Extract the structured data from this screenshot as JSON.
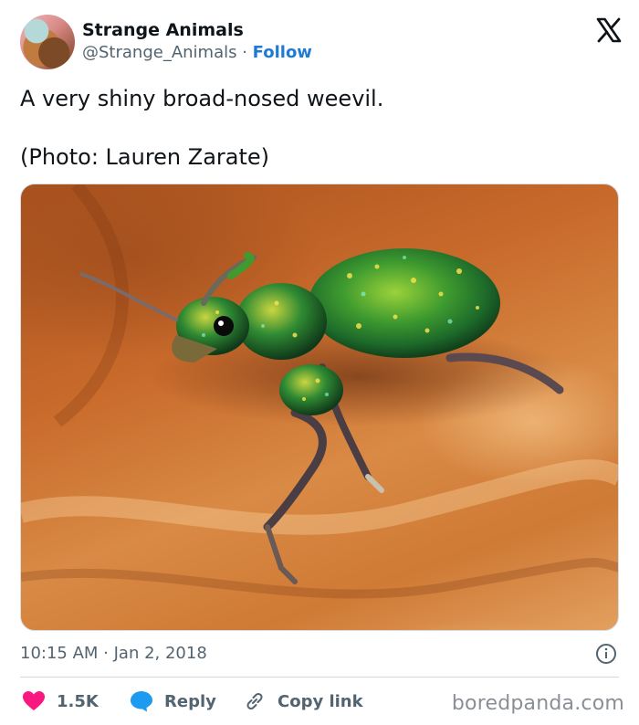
{
  "author": {
    "display_name": "Strange Animals",
    "handle": "@Strange_Animals",
    "separator": " · ",
    "follow_label": "Follow"
  },
  "tweet": {
    "text": "A very shiny broad-nosed weevil.\n\n(Photo: Lauren Zarate)",
    "timestamp": "10:15 AM · Jan 2, 2018"
  },
  "media": {
    "image_label": "green-iridescent-weevil-photo",
    "colors": {
      "wood": "#c86a2b",
      "beetle": "#3f9b2f"
    }
  },
  "actions": {
    "likes_count": "1.5K",
    "reply_label": "Reply",
    "copy_link_label": "Copy link"
  },
  "icons": {
    "platform": "x-logo-icon",
    "info": "info-icon",
    "like": "heart-icon",
    "reply": "speech-bubble-icon",
    "copy": "link-icon"
  },
  "colors": {
    "like": "#f91880",
    "reply": "#1d9bf0",
    "follow": "#1d7bd6",
    "muted": "#536471"
  },
  "watermark": "boredpanda.com"
}
